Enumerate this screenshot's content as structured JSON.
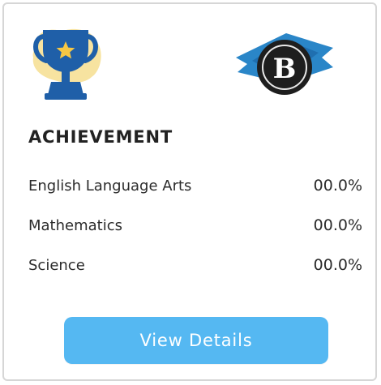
{
  "card": {
    "title": "ACHIEVEMENT",
    "badge_letter": "B",
    "rows": [
      {
        "subject": "English Language Arts",
        "value": "00.0%"
      },
      {
        "subject": "Mathematics",
        "value": "00.0%"
      },
      {
        "subject": "Science",
        "value": "00.0%"
      }
    ],
    "button_label": "View Details"
  },
  "colors": {
    "trophy_blue": "#1f5fa8",
    "trophy_backdrop": "#f7e3a0",
    "star": "#f6c744",
    "ribbon_blue": "#2a86c8",
    "badge_dark": "#1e1e1e",
    "button_blue": "#55b8f2"
  },
  "icons": {
    "trophy": "trophy-icon",
    "badge": "ribbon-badge-icon"
  }
}
